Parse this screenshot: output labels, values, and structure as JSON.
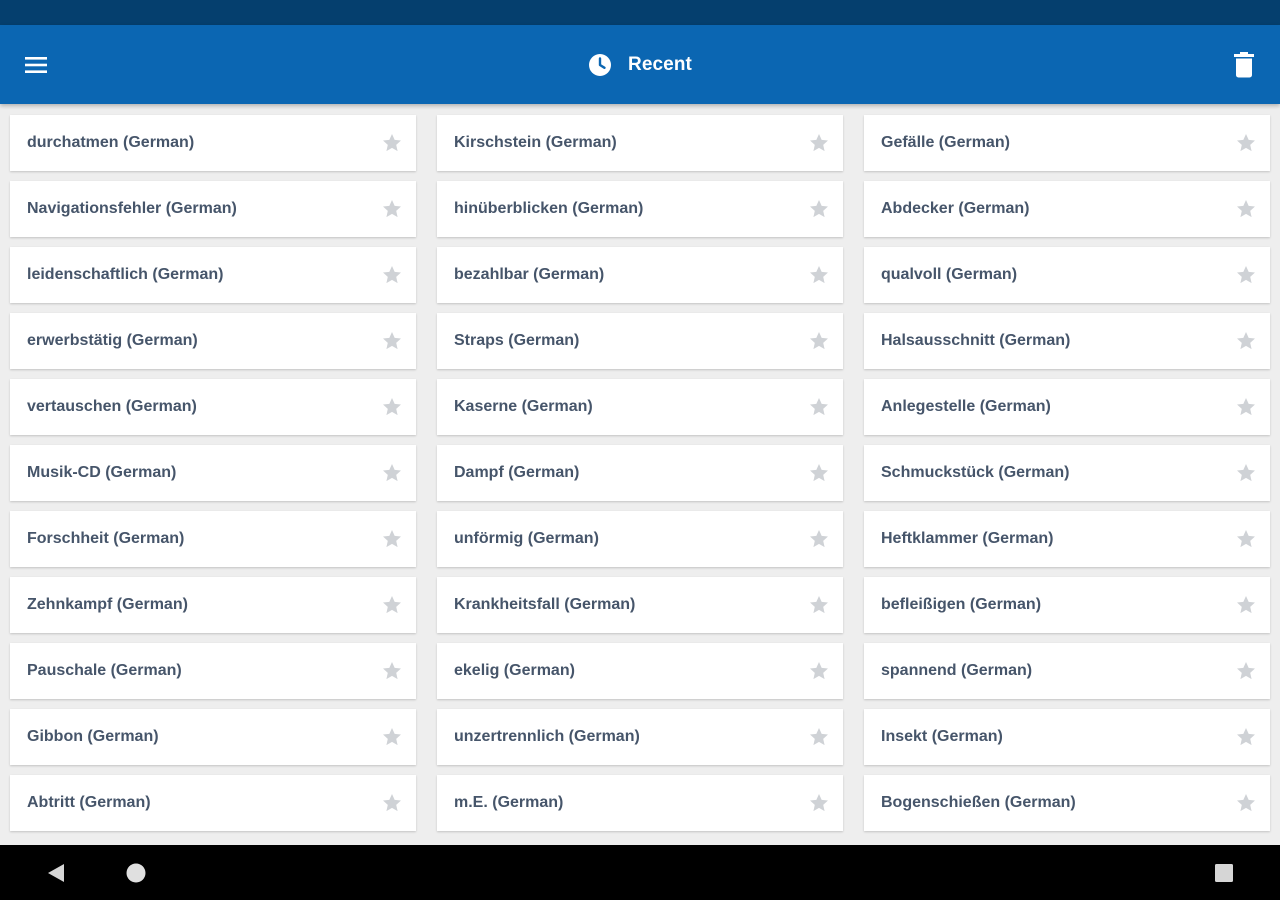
{
  "app_bar": {
    "title": "Recent",
    "menu_icon": "hamburger-menu-icon",
    "title_icon": "clock-icon",
    "action_icon": "trash-icon",
    "background_color": "#0b66b2",
    "status_bar_color": "#053f6e"
  },
  "entries": [
    {
      "label": "durchatmen (German)"
    },
    {
      "label": "Kirschstein (German)"
    },
    {
      "label": "Gefälle (German)"
    },
    {
      "label": "Navigationsfehler (German)"
    },
    {
      "label": "hinüberblicken (German)"
    },
    {
      "label": "Abdecker (German)"
    },
    {
      "label": "leidenschaftlich (German)"
    },
    {
      "label": "bezahlbar (German)"
    },
    {
      "label": "qualvoll (German)"
    },
    {
      "label": "erwerbstätig (German)"
    },
    {
      "label": "Straps (German)"
    },
    {
      "label": "Halsausschnitt (German)"
    },
    {
      "label": "vertauschen (German)"
    },
    {
      "label": "Kaserne (German)"
    },
    {
      "label": "Anlegestelle (German)"
    },
    {
      "label": "Musik-CD (German)"
    },
    {
      "label": "Dampf (German)"
    },
    {
      "label": "Schmuckstück (German)"
    },
    {
      "label": "Forschheit (German)"
    },
    {
      "label": "unförmig (German)"
    },
    {
      "label": "Heftklammer (German)"
    },
    {
      "label": "Zehnkampf (German)"
    },
    {
      "label": "Krankheitsfall (German)"
    },
    {
      "label": "befleißigen (German)"
    },
    {
      "label": "Pauschale (German)"
    },
    {
      "label": "ekelig (German)"
    },
    {
      "label": "spannend (German)"
    },
    {
      "label": "Gibbon (German)"
    },
    {
      "label": "unzertrennlich (German)"
    },
    {
      "label": "Insekt (German)"
    },
    {
      "label": "Abtritt (German)"
    },
    {
      "label": "m.E. (German)"
    },
    {
      "label": "Bogenschießen (German)"
    }
  ],
  "entry_icon": "star-icon",
  "nav_bar": {
    "back_icon": "back-triangle-icon",
    "home_icon": "home-circle-icon",
    "recents_icon": "recents-square-icon"
  }
}
